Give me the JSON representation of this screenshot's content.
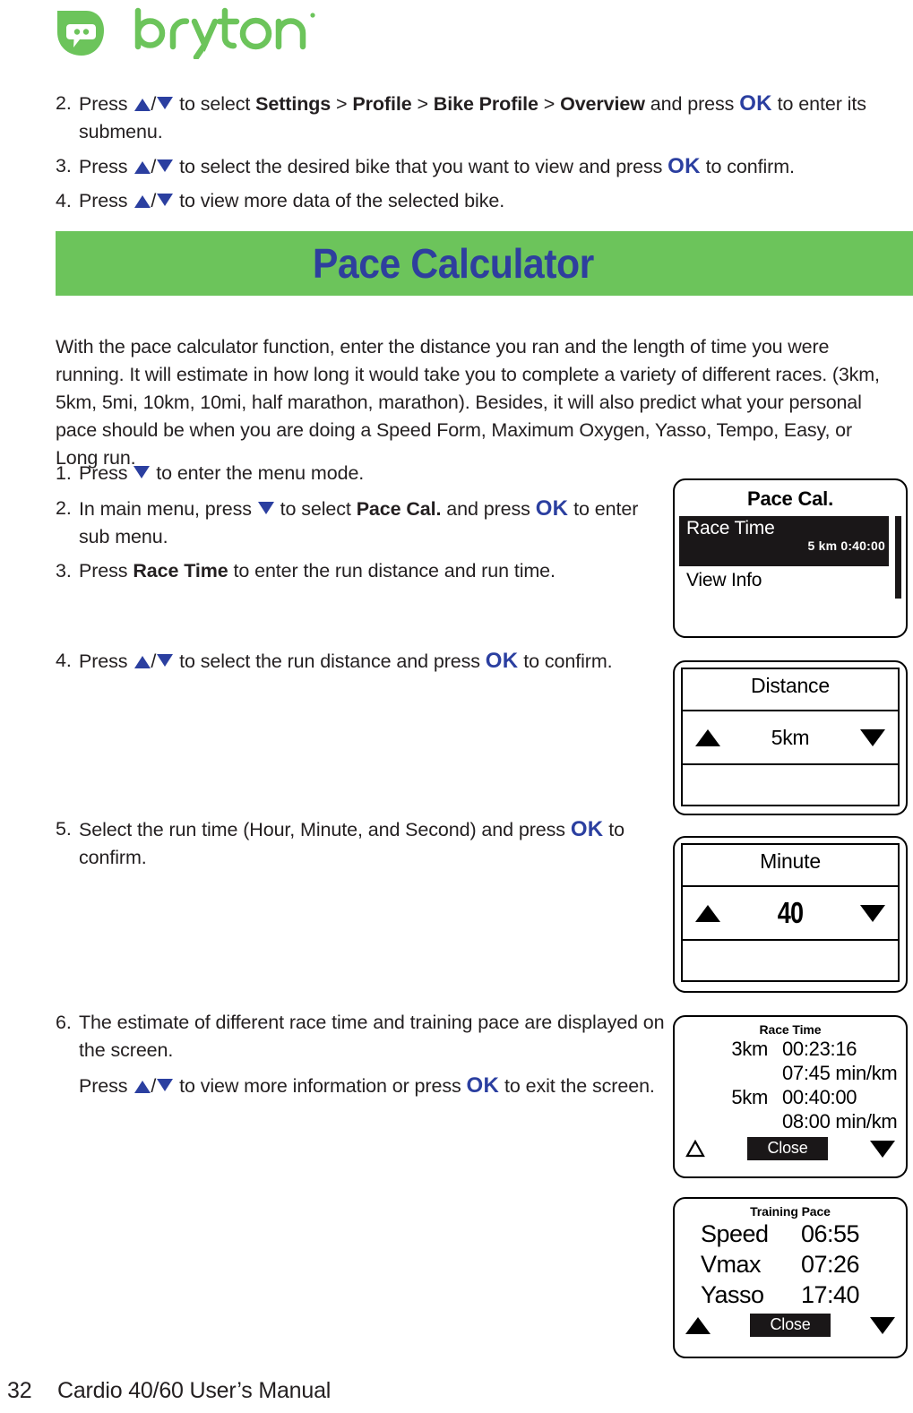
{
  "brand": {
    "logo_icon": "bryton-leaf-icon",
    "wordmark": "bryton"
  },
  "steps_top": [
    {
      "num": "2.",
      "parts": [
        {
          "t": "Press ",
          "s": "plain"
        },
        {
          "t": "",
          "s": "tri-up"
        },
        {
          "t": "/",
          "s": "plain"
        },
        {
          "t": "",
          "s": "tri-down"
        },
        {
          "t": " to select ",
          "s": "plain"
        },
        {
          "t": "Settings",
          "s": "bold"
        },
        {
          "t": " > ",
          "s": "plain"
        },
        {
          "t": "Profile",
          "s": "bold"
        },
        {
          "t": " > ",
          "s": "plain"
        },
        {
          "t": "Bike Profile",
          "s": "bold"
        },
        {
          "t": " > ",
          "s": "plain"
        },
        {
          "t": "Overview",
          "s": "bold"
        },
        {
          "t": " and press ",
          "s": "plain"
        },
        {
          "t": "OK",
          "s": "ok"
        },
        {
          "t": " to enter its submenu.",
          "s": "plain"
        }
      ]
    },
    {
      "num": "3.",
      "parts": [
        {
          "t": "Press ",
          "s": "plain"
        },
        {
          "t": "",
          "s": "tri-up"
        },
        {
          "t": "/",
          "s": "plain"
        },
        {
          "t": "",
          "s": "tri-down"
        },
        {
          "t": " to select the desired bike that you want to view and press ",
          "s": "plain"
        },
        {
          "t": "OK",
          "s": "ok"
        },
        {
          "t": " to confirm.",
          "s": "plain"
        }
      ]
    },
    {
      "num": "4.",
      "parts": [
        {
          "t": "Press ",
          "s": "plain"
        },
        {
          "t": "",
          "s": "tri-up"
        },
        {
          "t": "/",
          "s": "plain"
        },
        {
          "t": "",
          "s": "tri-down"
        },
        {
          "t": " to view more data of the selected bike.",
          "s": "plain"
        }
      ]
    }
  ],
  "banner": {
    "title": "Pace Calculator",
    "background_color": "#6cc45b",
    "title_color": "#2e3f9e"
  },
  "intro": "With the pace calculator function, enter the distance you ran and the length of time you were running. It will estimate in how long it would take you to complete a variety of different races. (3km, 5km, 5mi, 10km, 10mi, half marathon, marathon). Besides, it will also predict what your personal pace should be when you are doing a Speed Form, Maximum Oxygen, Yasso, Tempo, Easy, or Long run.",
  "steps_lower": {
    "s1": {
      "num": "1.",
      "parts": [
        {
          "t": "Press ",
          "s": "plain"
        },
        {
          "t": "",
          "s": "tri-down"
        },
        {
          "t": " to enter the menu mode.",
          "s": "plain"
        }
      ]
    },
    "s2": {
      "num": "2.",
      "parts": [
        {
          "t": "In main menu, press ",
          "s": "plain"
        },
        {
          "t": "",
          "s": "tri-down"
        },
        {
          "t": " to select ",
          "s": "plain"
        },
        {
          "t": "Pace Cal.",
          "s": "bold"
        },
        {
          "t": " and press ",
          "s": "plain"
        },
        {
          "t": "OK",
          "s": "ok"
        },
        {
          "t": " to enter sub menu.",
          "s": "plain"
        }
      ]
    },
    "s3": {
      "num": "3.",
      "parts": [
        {
          "t": "Press ",
          "s": "plain"
        },
        {
          "t": "Race Time",
          "s": "bold"
        },
        {
          "t": " to enter the run distance and run time.",
          "s": "plain"
        }
      ]
    },
    "s4": {
      "num": "4.",
      "parts": [
        {
          "t": "Press ",
          "s": "plain"
        },
        {
          "t": "",
          "s": "tri-up"
        },
        {
          "t": "/",
          "s": "plain"
        },
        {
          "t": "",
          "s": "tri-down"
        },
        {
          "t": " to select the run distance and press ",
          "s": "plain"
        },
        {
          "t": "OK",
          "s": "ok"
        },
        {
          "t": " to confirm.",
          "s": "plain"
        }
      ]
    },
    "s5": {
      "num": "5.",
      "parts": [
        {
          "t": "Select the run time (Hour, Minute, and Second) and press ",
          "s": "plain"
        },
        {
          "t": "OK",
          "s": "ok"
        },
        {
          "t": " to confirm.",
          "s": "plain"
        }
      ]
    },
    "s6": {
      "num": "6.",
      "parts": [
        {
          "t": "The estimate of different race time and training pace are displayed on the screen.",
          "s": "plain"
        }
      ]
    },
    "s6b": {
      "num": "",
      "parts": [
        {
          "t": "Press ",
          "s": "plain"
        },
        {
          "t": "",
          "s": "tri-up"
        },
        {
          "t": "/",
          "s": "plain"
        },
        {
          "t": "",
          "s": "tri-down"
        },
        {
          "t": " to view more information or press ",
          "s": "plain"
        },
        {
          "t": "OK",
          "s": "ok"
        },
        {
          "t": " to exit the screen.",
          "s": "plain"
        }
      ]
    }
  },
  "devices": {
    "pace_cal": {
      "title": "Pace Cal.",
      "selected_item": "Race Time",
      "selected_value": "5 km 0:40:00",
      "second_item": "View Info"
    },
    "distance": {
      "title": "Distance",
      "value": "5km",
      "up_icon": "triangle-up-icon",
      "down_icon": "triangle-down-icon"
    },
    "minute": {
      "title": "Minute",
      "value": "40",
      "up_icon": "triangle-up-icon",
      "down_icon": "triangle-down-icon"
    },
    "race_time": {
      "title": "Race Time",
      "rows": [
        {
          "label": "3km",
          "time": "00:23:16",
          "pace": "07:45 min/km"
        },
        {
          "label": "5km",
          "time": "00:40:00",
          "pace": "08:00 min/km"
        }
      ],
      "close_label": "Close",
      "up_icon": "triangle-up-outline-icon",
      "down_icon": "triangle-down-icon"
    },
    "training_pace": {
      "title": "Training Pace",
      "rows": [
        {
          "label": "Speed",
          "value": "06:55"
        },
        {
          "label": "Vmax",
          "value": "07:26"
        },
        {
          "label": "Yasso",
          "value": "17:40"
        }
      ],
      "close_label": "Close",
      "up_icon": "triangle-up-icon",
      "down_icon": "triangle-down-icon"
    }
  },
  "footer": {
    "page_number": "32",
    "manual_title": "Cardio 40/60 User’s Manual"
  }
}
